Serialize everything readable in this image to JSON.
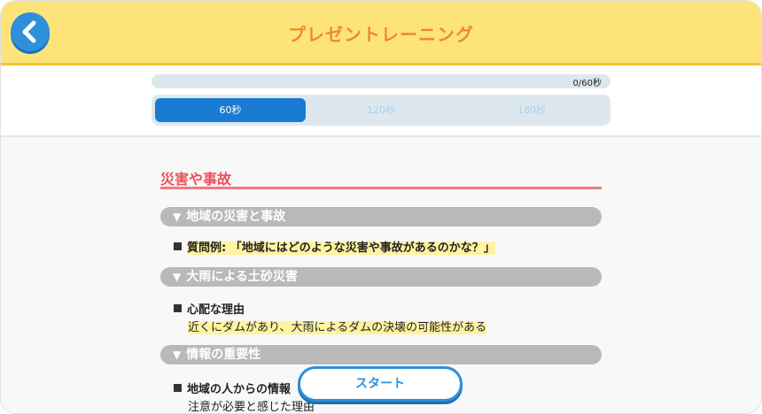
{
  "header": {
    "title": "プレゼントレーニング",
    "back_icon": "chevron-left-icon"
  },
  "progress": {
    "text": "0/60秒",
    "fraction": 0.0
  },
  "durations": [
    {
      "label": "60秒",
      "selected": true
    },
    {
      "label": "120秒",
      "selected": false
    },
    {
      "label": "180秒",
      "selected": false
    }
  ],
  "script": {
    "section_title": "災害や事故",
    "topics": [
      {
        "heading": "地域の災害と事故",
        "item_label": "質問例:",
        "item_text": "「地域にはどのような災害や事故があるのかな？」"
      },
      {
        "heading": "大雨による土砂災害",
        "item_label": "心配な理由",
        "item_text": "近くにダムがあり、大雨によるダムの決壊の可能性がある"
      },
      {
        "heading": "情報の重要性",
        "item_label": "地域の人からの情報",
        "item_text": "注意が必要と感じた理由"
      }
    ]
  },
  "start_button": {
    "label": "スタート"
  },
  "colors": {
    "accent_blue": "#2e8fdb",
    "header_yellow": "#fde47a",
    "title_orange": "#ef8a2a",
    "section_red": "#f04e5a"
  }
}
